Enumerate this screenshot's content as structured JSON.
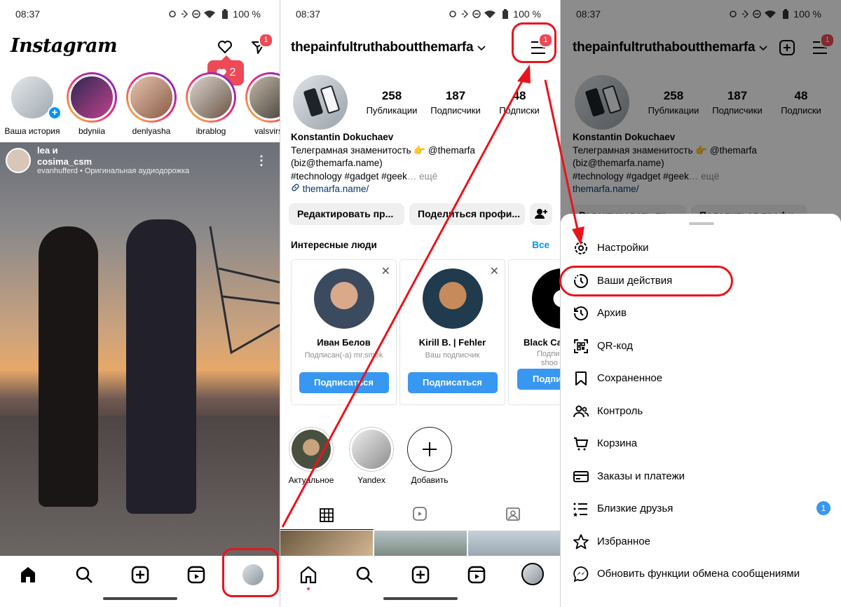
{
  "status": {
    "time": "08:37",
    "battery": "100 %"
  },
  "feed": {
    "logo": "Instagram",
    "dm_badge": "1",
    "likes_popup": "2",
    "stories": [
      {
        "name": "Ваша история"
      },
      {
        "name": "bdyniia"
      },
      {
        "name": "denlyasha"
      },
      {
        "name": "ibrablog"
      },
      {
        "name": "valsvirsk"
      }
    ],
    "post": {
      "user_line1": "lea и",
      "user_line2": "cosima_csm",
      "subline": "evanhufferd • Оригинальная аудиодорожка"
    }
  },
  "profile": {
    "username": "thepainfultruthaboutthemarfa",
    "menu_badge": "1",
    "stats": [
      {
        "value": "258",
        "label": "Публикации"
      },
      {
        "value": "187",
        "label": "Подписчики"
      },
      {
        "value": "48",
        "label": "Подписки"
      }
    ],
    "bio": {
      "name": "Konstantin Dokuchaev",
      "line1": "Телеграмная знаменитость 👉 @themarfa",
      "line2": "(biz@themarfa.name)",
      "line3": "#technology #gadget #geek",
      "more": "… ещё",
      "link": "themarfa.name/"
    },
    "buttons": {
      "edit": "Редактировать пр...",
      "share": "Поделиться профи..."
    },
    "suggested": {
      "title": "Интересные люди",
      "all": "Все",
      "cards": [
        {
          "name": "Иван Белов",
          "sub": "Подписан(-а) mr.smek",
          "button": "Подписаться"
        },
        {
          "name": "Kirill B. | Fehler",
          "sub": "Ваш подписчик",
          "button": "Подписаться"
        },
        {
          "name": "Black Ca",
          "sub": "Подпи",
          "sub2": "shoo",
          "button": "Подпи"
        }
      ]
    },
    "highlights": [
      {
        "label": "Актуальное"
      },
      {
        "label": "Yandex"
      },
      {
        "label": "Добавить"
      }
    ]
  },
  "menu": {
    "items": [
      {
        "label": "Настройки",
        "icon": "settings-icon"
      },
      {
        "label": "Ваши действия",
        "icon": "activity-icon"
      },
      {
        "label": "Архив",
        "icon": "archive-icon"
      },
      {
        "label": "QR-код",
        "icon": "qr-icon"
      },
      {
        "label": "Сохраненное",
        "icon": "bookmark-icon"
      },
      {
        "label": "Контроль",
        "icon": "supervision-icon"
      },
      {
        "label": "Корзина",
        "icon": "cart-icon"
      },
      {
        "label": "Заказы и платежи",
        "icon": "card-icon"
      },
      {
        "label": "Близкие друзья",
        "icon": "close-friends-icon",
        "badge": "1"
      },
      {
        "label": "Избранное",
        "icon": "star-icon"
      },
      {
        "label": "Обновить функции обмена сообщениями",
        "icon": "messenger-icon"
      }
    ]
  },
  "colors": {
    "annotation": "#e8141c",
    "accent": "#3897f0",
    "badge": "#ed4956"
  }
}
